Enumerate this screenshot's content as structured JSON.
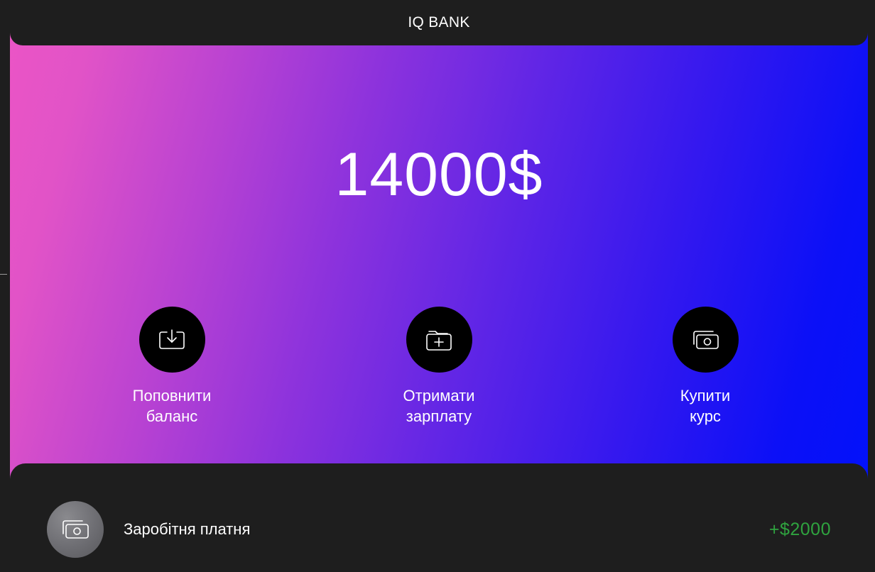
{
  "app": {
    "title": "IQ BANK"
  },
  "account": {
    "balance": "14000$"
  },
  "actions": [
    {
      "label_line1": "Поповнити",
      "label_line2": "баланс",
      "icon": "download-icon"
    },
    {
      "label_line1": "Отримати",
      "label_line2": "зарплату",
      "icon": "folder-add-icon"
    },
    {
      "label_line1": "Купити",
      "label_line2": "курс",
      "icon": "cash-icon"
    }
  ],
  "transactions": [
    {
      "title": "Заробітня платня",
      "amount": "+$2000",
      "icon": "cash-icon"
    }
  ],
  "colors": {
    "background": "#1e1e1e",
    "gradient_start": "#ec55c6",
    "gradient_end": "#0012fb",
    "action_button": "#000000",
    "amount_positive": "#2fa33f"
  }
}
